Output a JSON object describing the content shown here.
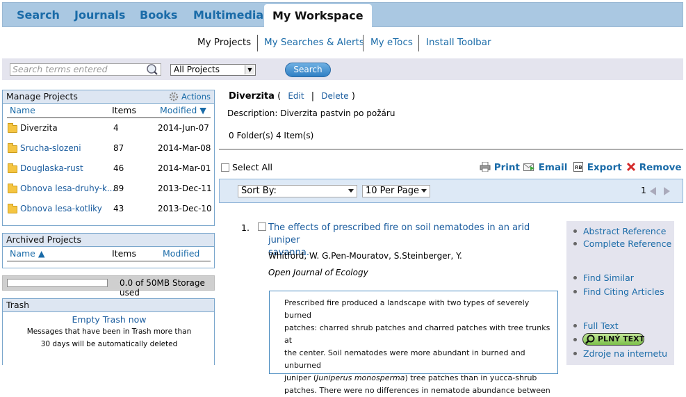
{
  "topnav": {
    "tabs": [
      {
        "label": "Search"
      },
      {
        "label": "Journals"
      },
      {
        "label": "Books"
      },
      {
        "label": "Multimedia"
      },
      {
        "label": "My Workspace",
        "active": true
      }
    ]
  },
  "subnav": {
    "items": [
      {
        "label": "My Projects",
        "current": true
      },
      {
        "label": "My Searches & Alerts"
      },
      {
        "label": "My eTocs"
      },
      {
        "label": "Install Toolbar"
      }
    ]
  },
  "searchbar": {
    "placeholder": "Search terms entered",
    "scope_value": "All Projects",
    "button_label": "Search"
  },
  "manage_projects": {
    "title": "Manage Projects",
    "actions_label": "Actions",
    "columns": {
      "name": "Name",
      "items": "Items",
      "modified": "Modified ▼"
    },
    "rows": [
      {
        "name": "Diverzita",
        "items": "4",
        "modified": "2014-Jun-07",
        "selected": true
      },
      {
        "name": "Srucha-slozeni",
        "items": "87",
        "modified": "2014-Mar-08"
      },
      {
        "name": "Douglaska-rust",
        "items": "46",
        "modified": "2014-Mar-01"
      },
      {
        "name": "Obnova lesa-druhy-k...",
        "items": "89",
        "modified": "2013-Dec-11"
      },
      {
        "name": "Obnova lesa-kotliky",
        "items": "43",
        "modified": "2013-Dec-10"
      }
    ]
  },
  "archived_projects": {
    "title": "Archived Projects",
    "columns": {
      "name": "Name ▲",
      "items": "Items",
      "modified": "Modified"
    }
  },
  "storage": {
    "label": "0.0 of 50MB Storage used",
    "used_fraction": 0.0
  },
  "trash": {
    "title": "Trash",
    "empty_label": "Empty Trash now",
    "message_line1": "Messages that have been in Trash more than",
    "message_line2": "30 days will be automatically deleted"
  },
  "project": {
    "name": "Diverzita",
    "open_paren": "(",
    "edit_label": "Edit",
    "sep": "|",
    "delete_label": "Delete",
    "close_paren": ")",
    "description_label": "Description:",
    "description_value": "Diverzita pastvin po požáru",
    "counts": "0 Folder(s) 4 Item(s)"
  },
  "toolbar": {
    "select_all": "Select All",
    "print": "Print",
    "email": "Email",
    "export": "Export",
    "remove": "Remove"
  },
  "pager": {
    "sort_value": "Sort By:",
    "per_page_value": "10 Per Page",
    "page": "1"
  },
  "result": {
    "number": "1.",
    "title_line1": "The effects of prescribed fire on soil nematodes in an arid juniper",
    "title_line2": "savanna.",
    "authors": "Whitford, W. G.Pen-Mouratov, S.Steinberger, Y.",
    "journal": "Open Journal of Ecology",
    "abstract_lines": [
      "Prescribed fire produced a landscape with two types of severely burned",
      "patches: charred shrub patches and charred patches with tree trunks at",
      "the center. Soil nematodes were more abundant in burned and unburned",
      "juniper (",
      "Juniperus monosperma",
      ") tree patches than in yucca-shrub",
      "patches. There were no differences in nematode abundance between"
    ],
    "links": {
      "abstract_reference": "Abstract Reference",
      "complete_reference": "Complete Reference",
      "find_similar": "Find Similar",
      "find_citing": "Find Citing Articles",
      "full_text": "Full Text",
      "plny_text": "PLNÝ TEXT",
      "zdroje": "Zdroje na internetu"
    }
  }
}
